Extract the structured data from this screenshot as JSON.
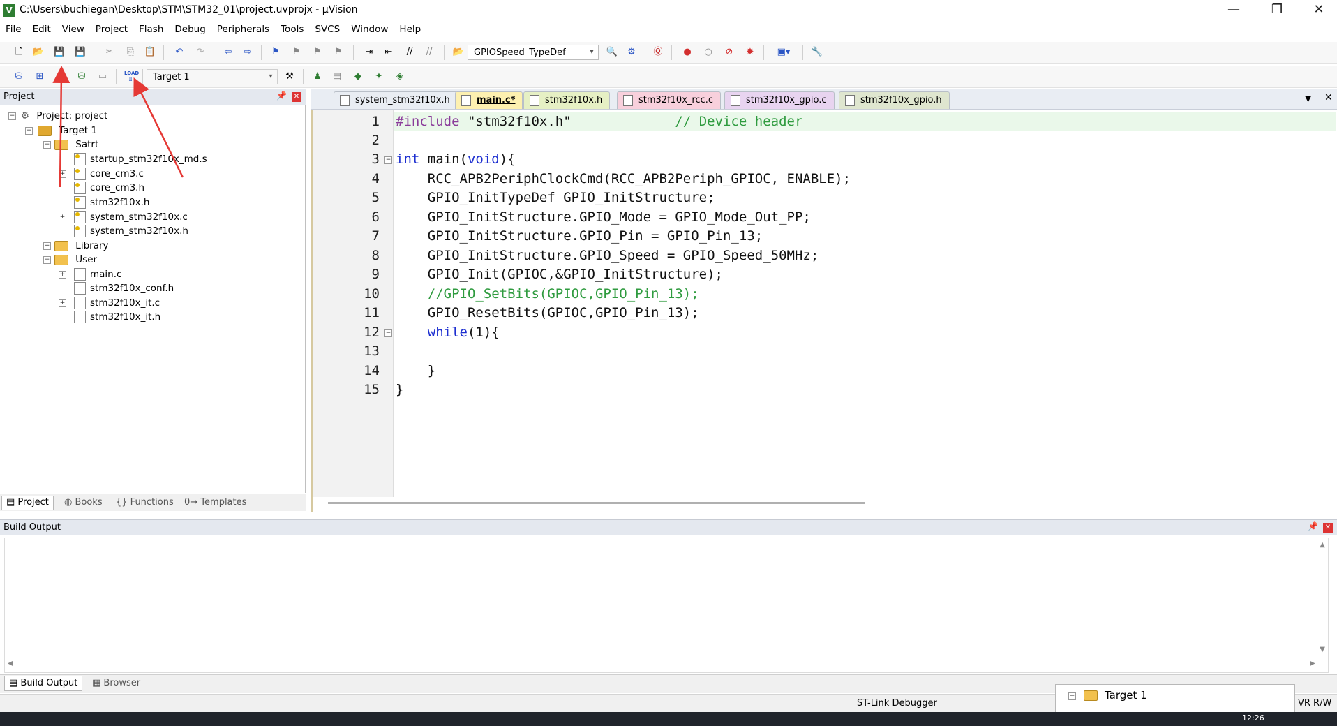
{
  "window": {
    "title": "C:\\Users\\buchiegan\\Desktop\\STM\\STM32_01\\project.uvprojx - µVision",
    "app_icon": "uvision-icon",
    "controls": [
      "minimize",
      "restore",
      "close"
    ]
  },
  "menu": [
    "File",
    "Edit",
    "View",
    "Project",
    "Flash",
    "Debug",
    "Peripherals",
    "Tools",
    "SVCS",
    "Window",
    "Help"
  ],
  "toolbar1": {
    "find_combo_value": "GPIOSpeed_TypeDef"
  },
  "toolbar2": {
    "target_combo_value": "Target 1",
    "load_icon_text": "LOAD"
  },
  "project_panel": {
    "title": "Project",
    "tree": [
      {
        "label": "Project: project",
        "level": 0
      },
      {
        "label": "Target 1",
        "level": 1
      },
      {
        "label": "Satrt",
        "level": 2
      },
      {
        "label": "startup_stm32f10x_md.s",
        "level": 3
      },
      {
        "label": "core_cm3.c",
        "level": 3
      },
      {
        "label": "core_cm3.h",
        "level": 3
      },
      {
        "label": "stm32f10x.h",
        "level": 3
      },
      {
        "label": "system_stm32f10x.c",
        "level": 3
      },
      {
        "label": "system_stm32f10x.h",
        "level": 3
      },
      {
        "label": "Library",
        "level": 2
      },
      {
        "label": "User",
        "level": 2
      },
      {
        "label": "main.c",
        "level": 3
      },
      {
        "label": "stm32f10x_conf.h",
        "level": 3
      },
      {
        "label": "stm32f10x_it.c",
        "level": 3
      },
      {
        "label": "stm32f10x_it.h",
        "level": 3
      }
    ],
    "tabs": [
      "Project",
      "Books",
      "{} Functions",
      "0→ Templates"
    ]
  },
  "editor": {
    "tabs": [
      "system_stm32f10x.h",
      "main.c*",
      "stm32f10x.h",
      "stm32f10x_rcc.c",
      "stm32f10x_gpio.c",
      "stm32f10x_gpio.h"
    ],
    "active_tab": "main.c*",
    "line_numbers": [
      "1",
      "2",
      "3",
      "4",
      "5",
      "6",
      "7",
      "8",
      "9",
      "10",
      "11",
      "12",
      "13",
      "14",
      "15"
    ],
    "lines": {
      "l1_pp": "#include ",
      "l1_str": "\"stm32f10x.h\"",
      "l1_cm": "             // Device header",
      "l3_kw1": "int",
      "l3_a": " main(",
      "l3_kw2": "void",
      "l3_b": "){",
      "l4": "    RCC_APB2PeriphClockCmd(RCC_APB2Periph_GPIOC, ENABLE);",
      "l5": "    GPIO_InitTypeDef GPIO_InitStructure;",
      "l6": "    GPIO_InitStructure.GPIO_Mode = GPIO_Mode_Out_PP;",
      "l7": "    GPIO_InitStructure.GPIO_Pin = GPIO_Pin_13;",
      "l8": "    GPIO_InitStructure.GPIO_Speed = GPIO_Speed_50MHz;",
      "l9": "    GPIO_Init(GPIOC,&GPIO_InitStructure);",
      "l10": "    //GPIO_SetBits(GPIOC,GPIO_Pin_13);",
      "l11": "    GPIO_ResetBits(GPIOC,GPIO_Pin_13);",
      "l12_pre": "    ",
      "l12_kw": "while",
      "l12_post": "(1){",
      "l13": "",
      "l14": "    }",
      "l15": "}"
    }
  },
  "build_output": {
    "title": "Build Output",
    "tabs": [
      "Build Output",
      "Browser"
    ]
  },
  "statusbar": {
    "debugger": "ST-Link Debugger",
    "flags": "VR R/W"
  },
  "popup": {
    "label": "Target 1"
  },
  "taskbar": {
    "clock": "12:26"
  },
  "colors": {
    "keyword": "#1d2fd0",
    "preprocessor": "#8a3c9a",
    "comment": "#2f9b3f",
    "annotation_arrow": "#e53935"
  }
}
